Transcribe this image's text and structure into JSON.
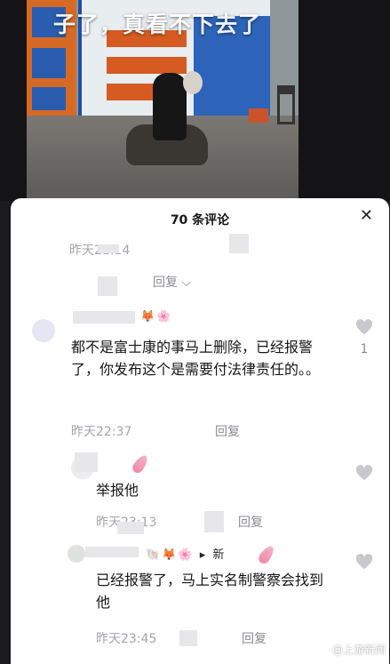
{
  "video": {
    "overlay_caption": "子了，真看不下去了"
  },
  "comments_header": {
    "title": "70 条评论",
    "close_icon": "close-icon"
  },
  "comments": [
    {
      "time": "昨天21:14",
      "reply_toggle": "回复",
      "chevron_icon": "chevron-down-icon"
    },
    {
      "decoration": "🦊🌸",
      "text": "都不是富士康的事马上删除，已经报警了，你发布这个是需要付法律责任的。。",
      "time": "昨天22:37",
      "reply": "回复",
      "likes": "1",
      "heart_icon": "heart-icon"
    },
    {
      "decoration": "🪶",
      "text": "举报他",
      "time": "昨天23:13",
      "reply": "回复",
      "heart_icon": "heart-icon"
    },
    {
      "decoration": "🐚🦊🌸 ▸ 新",
      "text": "已经报警了，马上实名制警察会找到他",
      "time": "昨天23:45",
      "reply": "回复",
      "heart_icon": "heart-icon"
    }
  ],
  "watermark": {
    "text": "@上游新闻"
  },
  "colors": {
    "sheet_background": "#ffffff",
    "meta_text": "#a6a6ab",
    "body_text": "#161616",
    "heart": "#c9c9cd"
  }
}
